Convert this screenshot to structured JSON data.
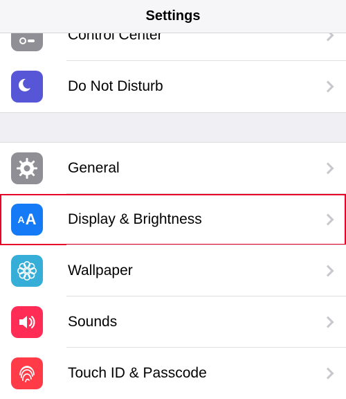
{
  "header": {
    "title": "Settings"
  },
  "group1": {
    "items": [
      {
        "label": "Control Center"
      },
      {
        "label": "Do Not Disturb"
      }
    ]
  },
  "group2": {
    "items": [
      {
        "label": "General"
      },
      {
        "label": "Display & Brightness"
      },
      {
        "label": "Wallpaper"
      },
      {
        "label": "Sounds"
      },
      {
        "label": "Touch ID & Passcode"
      }
    ]
  },
  "highlighted": "Display & Brightness"
}
